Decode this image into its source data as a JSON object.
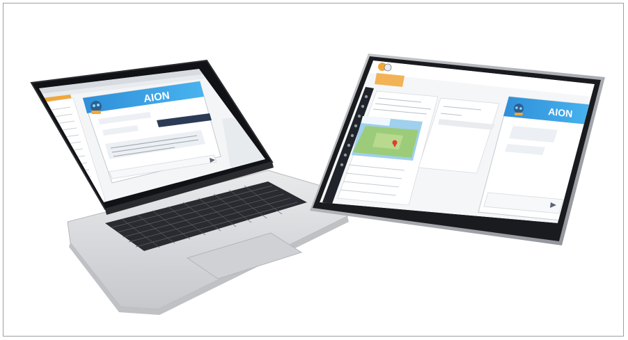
{
  "scene": {
    "colors": {
      "background": "#ffffff",
      "frame_border": "#9aa0a6",
      "laptop_body": "#d9dadd",
      "laptop_bezel": "#111216",
      "keyboard_key": "#2a2b30",
      "tablet_bezel": "#1a1b1f",
      "accent_blue": "#3aa0e6",
      "accent_orange": "#f0a73a",
      "chat_bubble_dark": "#2b3b55",
      "chat_bubble_light": "#eceff3",
      "map_land": "#9ccc7a",
      "map_water": "#9fd0ee"
    }
  },
  "laptop": {
    "chat_widget": {
      "brand": "AION",
      "icons": [
        "robot-avatar-icon",
        "send-icon",
        "close-icon"
      ]
    }
  },
  "tablet": {
    "chat_widget": {
      "brand": "AION",
      "icons": [
        "robot-avatar-icon",
        "send-icon"
      ]
    },
    "app": {
      "icons": [
        "app-logo-icon",
        "map-marker-icon",
        "sidebar-nav-icons"
      ]
    }
  }
}
